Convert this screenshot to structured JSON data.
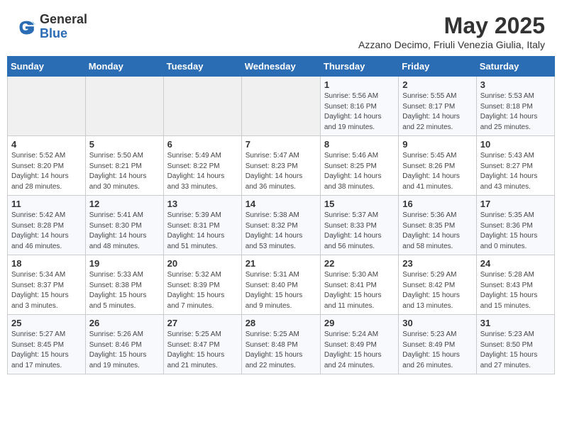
{
  "header": {
    "logo_general": "General",
    "logo_blue": "Blue",
    "month_title": "May 2025",
    "location": "Azzano Decimo, Friuli Venezia Giulia, Italy"
  },
  "weekdays": [
    "Sunday",
    "Monday",
    "Tuesday",
    "Wednesday",
    "Thursday",
    "Friday",
    "Saturday"
  ],
  "weeks": [
    [
      {
        "day": "",
        "info": ""
      },
      {
        "day": "",
        "info": ""
      },
      {
        "day": "",
        "info": ""
      },
      {
        "day": "",
        "info": ""
      },
      {
        "day": "1",
        "info": "Sunrise: 5:56 AM\nSunset: 8:16 PM\nDaylight: 14 hours\nand 19 minutes."
      },
      {
        "day": "2",
        "info": "Sunrise: 5:55 AM\nSunset: 8:17 PM\nDaylight: 14 hours\nand 22 minutes."
      },
      {
        "day": "3",
        "info": "Sunrise: 5:53 AM\nSunset: 8:18 PM\nDaylight: 14 hours\nand 25 minutes."
      }
    ],
    [
      {
        "day": "4",
        "info": "Sunrise: 5:52 AM\nSunset: 8:20 PM\nDaylight: 14 hours\nand 28 minutes."
      },
      {
        "day": "5",
        "info": "Sunrise: 5:50 AM\nSunset: 8:21 PM\nDaylight: 14 hours\nand 30 minutes."
      },
      {
        "day": "6",
        "info": "Sunrise: 5:49 AM\nSunset: 8:22 PM\nDaylight: 14 hours\nand 33 minutes."
      },
      {
        "day": "7",
        "info": "Sunrise: 5:47 AM\nSunset: 8:23 PM\nDaylight: 14 hours\nand 36 minutes."
      },
      {
        "day": "8",
        "info": "Sunrise: 5:46 AM\nSunset: 8:25 PM\nDaylight: 14 hours\nand 38 minutes."
      },
      {
        "day": "9",
        "info": "Sunrise: 5:45 AM\nSunset: 8:26 PM\nDaylight: 14 hours\nand 41 minutes."
      },
      {
        "day": "10",
        "info": "Sunrise: 5:43 AM\nSunset: 8:27 PM\nDaylight: 14 hours\nand 43 minutes."
      }
    ],
    [
      {
        "day": "11",
        "info": "Sunrise: 5:42 AM\nSunset: 8:28 PM\nDaylight: 14 hours\nand 46 minutes."
      },
      {
        "day": "12",
        "info": "Sunrise: 5:41 AM\nSunset: 8:30 PM\nDaylight: 14 hours\nand 48 minutes."
      },
      {
        "day": "13",
        "info": "Sunrise: 5:39 AM\nSunset: 8:31 PM\nDaylight: 14 hours\nand 51 minutes."
      },
      {
        "day": "14",
        "info": "Sunrise: 5:38 AM\nSunset: 8:32 PM\nDaylight: 14 hours\nand 53 minutes."
      },
      {
        "day": "15",
        "info": "Sunrise: 5:37 AM\nSunset: 8:33 PM\nDaylight: 14 hours\nand 56 minutes."
      },
      {
        "day": "16",
        "info": "Sunrise: 5:36 AM\nSunset: 8:35 PM\nDaylight: 14 hours\nand 58 minutes."
      },
      {
        "day": "17",
        "info": "Sunrise: 5:35 AM\nSunset: 8:36 PM\nDaylight: 15 hours\nand 0 minutes."
      }
    ],
    [
      {
        "day": "18",
        "info": "Sunrise: 5:34 AM\nSunset: 8:37 PM\nDaylight: 15 hours\nand 3 minutes."
      },
      {
        "day": "19",
        "info": "Sunrise: 5:33 AM\nSunset: 8:38 PM\nDaylight: 15 hours\nand 5 minutes."
      },
      {
        "day": "20",
        "info": "Sunrise: 5:32 AM\nSunset: 8:39 PM\nDaylight: 15 hours\nand 7 minutes."
      },
      {
        "day": "21",
        "info": "Sunrise: 5:31 AM\nSunset: 8:40 PM\nDaylight: 15 hours\nand 9 minutes."
      },
      {
        "day": "22",
        "info": "Sunrise: 5:30 AM\nSunset: 8:41 PM\nDaylight: 15 hours\nand 11 minutes."
      },
      {
        "day": "23",
        "info": "Sunrise: 5:29 AM\nSunset: 8:42 PM\nDaylight: 15 hours\nand 13 minutes."
      },
      {
        "day": "24",
        "info": "Sunrise: 5:28 AM\nSunset: 8:43 PM\nDaylight: 15 hours\nand 15 minutes."
      }
    ],
    [
      {
        "day": "25",
        "info": "Sunrise: 5:27 AM\nSunset: 8:45 PM\nDaylight: 15 hours\nand 17 minutes."
      },
      {
        "day": "26",
        "info": "Sunrise: 5:26 AM\nSunset: 8:46 PM\nDaylight: 15 hours\nand 19 minutes."
      },
      {
        "day": "27",
        "info": "Sunrise: 5:25 AM\nSunset: 8:47 PM\nDaylight: 15 hours\nand 21 minutes."
      },
      {
        "day": "28",
        "info": "Sunrise: 5:25 AM\nSunset: 8:48 PM\nDaylight: 15 hours\nand 22 minutes."
      },
      {
        "day": "29",
        "info": "Sunrise: 5:24 AM\nSunset: 8:49 PM\nDaylight: 15 hours\nand 24 minutes."
      },
      {
        "day": "30",
        "info": "Sunrise: 5:23 AM\nSunset: 8:49 PM\nDaylight: 15 hours\nand 26 minutes."
      },
      {
        "day": "31",
        "info": "Sunrise: 5:23 AM\nSunset: 8:50 PM\nDaylight: 15 hours\nand 27 minutes."
      }
    ]
  ]
}
